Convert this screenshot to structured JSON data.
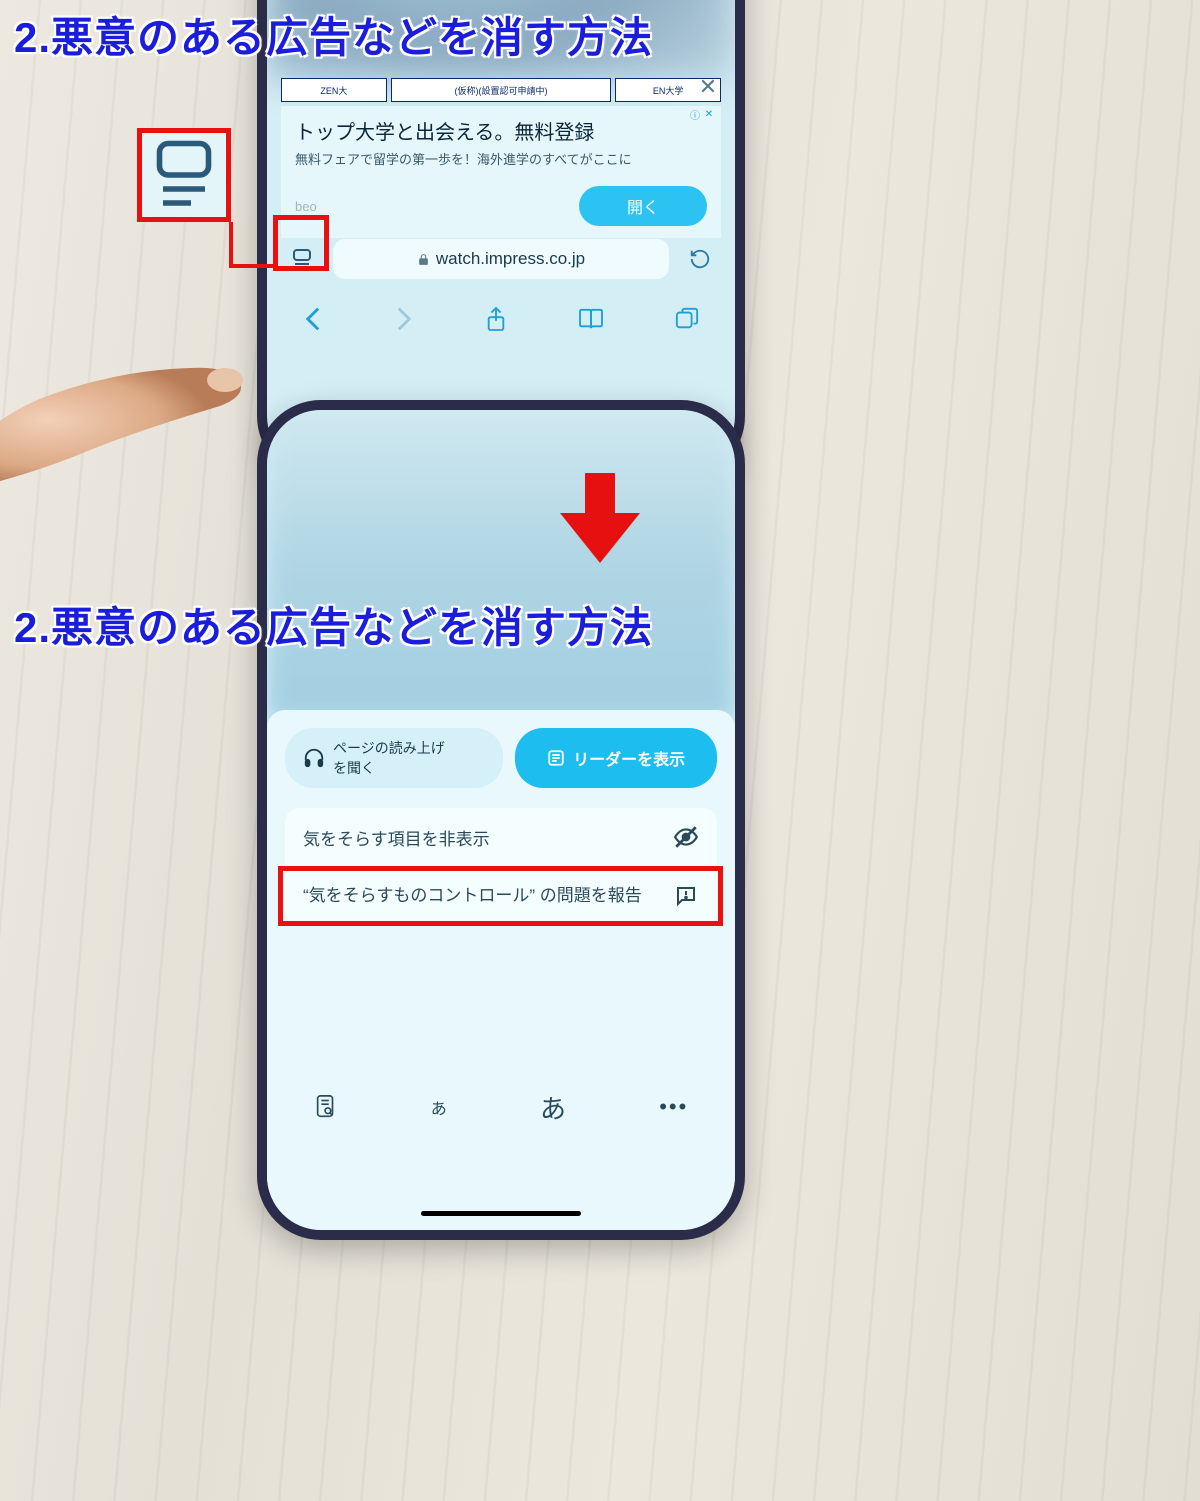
{
  "title": "2.悪意のある広告などを消す方法",
  "top_panel": {
    "ad_strip": [
      "ZEN大",
      "(仮称)(設置認可申請中)",
      "EN大学"
    ],
    "ad": {
      "title": "トップ大学と出会える。無料登録",
      "subtitle": "無料フェアで留学の第一歩を！海外進学のすべてがここに",
      "brand": "beo",
      "button": "開く"
    },
    "url": "watch.impress.co.jp"
  },
  "bottom_panel": {
    "listen_label_line1": "ページの読み上げ",
    "listen_label_line2": "を聞く",
    "reader_button": "リーダーを表示",
    "menu": {
      "hide_distractions": "気をそらす項目を非表示",
      "report_issue": "“気をそらすものコントロール” の問題を報告"
    },
    "font_options": {
      "small": "あ",
      "large": "あ"
    }
  }
}
